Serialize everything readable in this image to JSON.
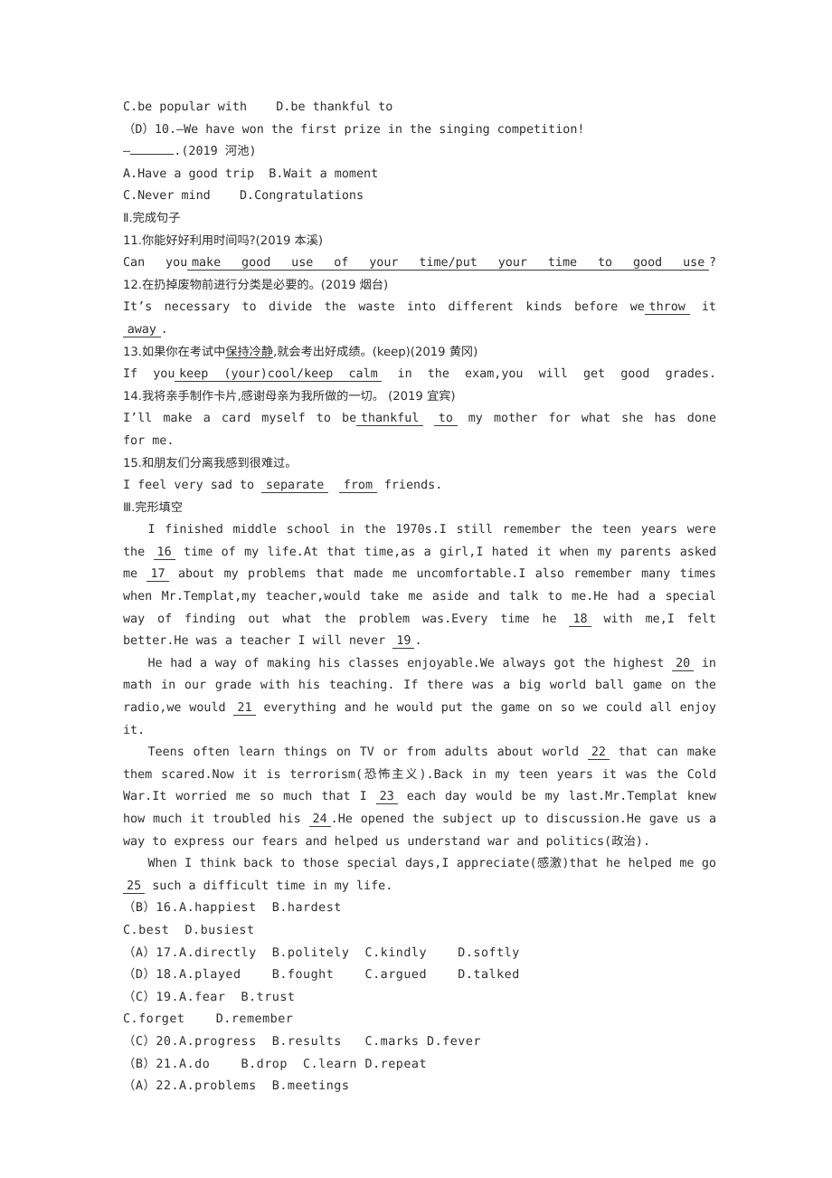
{
  "document": {
    "lines": [
      {
        "id": "l1",
        "text": "C.be popular with    D.be thankful to"
      },
      {
        "id": "l2",
        "text": "（D）10.—We have won the first prize in the singing competition!"
      },
      {
        "id": "l3a",
        "text": "—",
        "rule": true,
        "after": ".(2019 河池)"
      },
      {
        "id": "l4",
        "text": "A.Have a good trip  B.Wait a moment"
      },
      {
        "id": "l5",
        "text": "C.Never mind    D.Congratulations"
      },
      {
        "id": "l6",
        "text": "Ⅱ.完成句子"
      },
      {
        "id": "l7",
        "text": "11.你能好好利用时间吗?(2019 本溪)"
      },
      {
        "id": "l8",
        "pre": "Can you",
        "fill": "make good use of your time/put your time to good use",
        "post": "?"
      },
      {
        "id": "l9",
        "text": "12.在扔掉废物前进行分类是必要的。(2019 烟台)"
      },
      {
        "id": "l10",
        "pre": "It’s necessary to divide the waste into different kinds before we",
        "fill": "throw",
        "post": " it"
      },
      {
        "id": "l11",
        "fill2": "away",
        "post2": "."
      },
      {
        "id": "l12",
        "pre_cjk": "13.如果你在考试中",
        "u_cjk": "保持冷静",
        "post_cjk": ",就会考出好成绩。(keep)(2019 黄冈)"
      },
      {
        "id": "l13",
        "pre": "If you",
        "fill": "keep (your)cool/keep calm",
        "post": " in the exam,you will get good grades."
      },
      {
        "id": "l14",
        "text": "14.我将亲手制作卡片,感谢母亲为我所做的一切。 (2019 宜宾)"
      },
      {
        "id": "l15",
        "pre": "I’ll make a card myself to be",
        "fill": "thankful",
        "fill_b": "to",
        "post": " my mother for what she has done"
      },
      {
        "id": "l16",
        "text": "for me."
      },
      {
        "id": "l17",
        "text": "15.和朋友们分离我感到很难过。"
      },
      {
        "id": "l18",
        "pre": "I feel very sad to ",
        "fill": "separate",
        "fill_b": "from",
        "post": " friends."
      },
      {
        "id": "l19",
        "text": "Ⅲ.完形填空"
      }
    ],
    "passage": {
      "paragraphs": [
        {
          "id": "p1",
          "segments": [
            {
              "t": "I finished middle school in the 1970s.I still remember the teen years were the "
            },
            {
              "b": "16"
            },
            {
              "t": " time of my life.At that time,as a girl,I hated it when my parents asked me "
            },
            {
              "b": "17"
            },
            {
              "t": " about my problems that made me uncomfortable.I also remember many times when Mr.Templat,my teacher,would take me aside and talk to me.He had a special way of finding out what the problem was.Every time he "
            },
            {
              "b": "18"
            },
            {
              "t": " with me,I felt better.He was a teacher I will never "
            },
            {
              "b": "19"
            },
            {
              "t": "."
            }
          ]
        },
        {
          "id": "p2",
          "segments": [
            {
              "t": "He had a way of making his classes enjoyable.We always got the highest "
            },
            {
              "b": "20"
            },
            {
              "t": " in math in our grade with his teaching. If there was a big world ball game on the radio,we would "
            },
            {
              "b": "21"
            },
            {
              "t": " everything and he would put the game on so we could all enjoy it."
            }
          ]
        },
        {
          "id": "p3",
          "segments": [
            {
              "t": "Teens often learn things on TV or from adults about world "
            },
            {
              "b": "22"
            },
            {
              "t": " that can make them scared.Now it is terrorism(恐怖主义).Back in my teen years it was the Cold War.It worried me so much that I "
            },
            {
              "b": "23"
            },
            {
              "t": " each day would be my last.Mr.Templat knew how much it troubled his "
            },
            {
              "b": "24"
            },
            {
              "t": ".He opened the subject up to discussion.He gave us a way to express our fears and helped us understand war and politics(政治)."
            }
          ]
        },
        {
          "id": "p4",
          "segments": [
            {
              "t": "When I think back to those special days,I appreciate(感激)that he helped me go "
            },
            {
              "b": "25"
            },
            {
              "t": " such a difficult time in my life."
            }
          ]
        }
      ]
    },
    "answer_lines": [
      {
        "id": "a16",
        "text": "（B）16.A.happiest  B.hardest"
      },
      {
        "id": "a16b",
        "text": "C.best  D.busiest"
      },
      {
        "id": "a17",
        "text": "（A）17.A.directly  B.politely  C.kindly    D.softly"
      },
      {
        "id": "a18",
        "text": "（D）18.A.played    B.fought    C.argued    D.talked"
      },
      {
        "id": "a19",
        "text": "（C）19.A.fear  B.trust"
      },
      {
        "id": "a19b",
        "text": "C.forget    D.remember"
      },
      {
        "id": "a20",
        "text": "（C）20.A.progress  B.results   C.marks D.fever"
      },
      {
        "id": "a21",
        "text": "（B）21.A.do    B.drop  C.learn D.repeat"
      },
      {
        "id": "a22",
        "text": "（A）22.A.problems  B.meetings"
      }
    ]
  }
}
